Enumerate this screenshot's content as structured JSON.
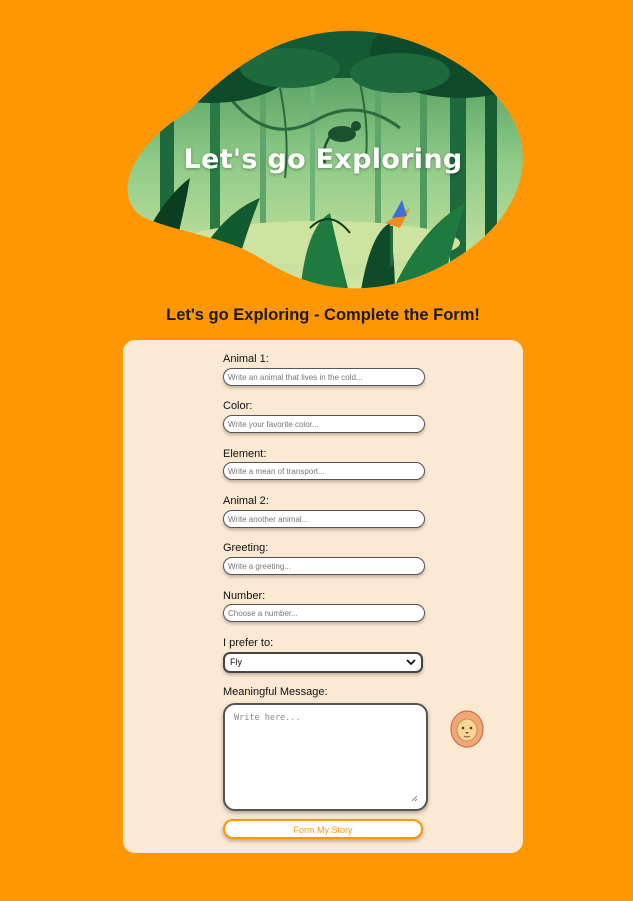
{
  "hero": {
    "title": "Let's go Exploring"
  },
  "form_heading": "Let's go Exploring - Complete the Form!",
  "fields": [
    {
      "label": "Animal 1:",
      "placeholder": "Write an animal that lives in the cold..."
    },
    {
      "label": "Color:",
      "placeholder": "Write your favorite color..."
    },
    {
      "label": "Element:",
      "placeholder": "Write a mean of transport..."
    },
    {
      "label": "Animal 2:",
      "placeholder": "Write another animal..."
    },
    {
      "label": "Greeting:",
      "placeholder": "Write a greeting..."
    },
    {
      "label": "Number:",
      "placeholder": "Choose a number..."
    }
  ],
  "preference": {
    "label": "I prefer to:",
    "selected": "Fly"
  },
  "message": {
    "label": "Meaningful Message:",
    "placeholder": "Write here..."
  },
  "submit_label": "Form My Story",
  "icons": {
    "mascot": "lion-icon",
    "dropdown": "chevron-down-icon"
  },
  "colors": {
    "background": "#FF9705",
    "card": "#FBE9D3",
    "accent": "#FF9705",
    "jungle_dark": "#0F4A2A",
    "jungle_light": "#8FCB87"
  }
}
